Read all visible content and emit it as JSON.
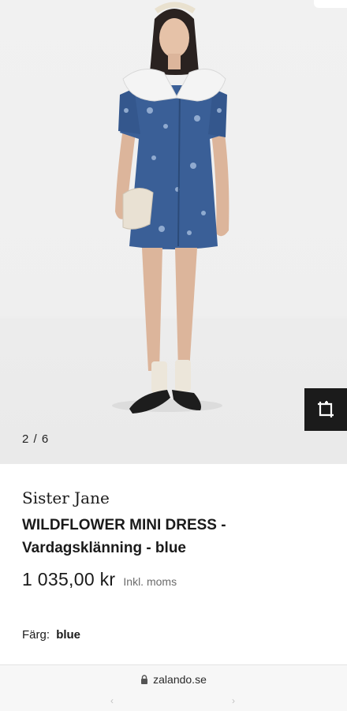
{
  "gallery": {
    "pager_text": "2 / 6",
    "image_alt": "Model wearing blue floral mini dress with white lace collar",
    "crop_icon": "crop-expand-icon"
  },
  "product": {
    "brand": "Sister Jane",
    "name": "WILDFLOWER MINI DRESS - Vardagsklänning - blue",
    "price": "1 035,00 kr",
    "vat_note": "Inkl. moms",
    "color_label": "Färg:",
    "color_value": "blue"
  },
  "browser": {
    "url": "zalando.se",
    "lock_icon": "lock-icon",
    "back_icon": "chevron-left-icon",
    "forward_icon": "chevron-right-icon"
  },
  "colors": {
    "dress": "#3a5f97",
    "collar": "#f4f4f4",
    "button_bg": "#1b1b1b"
  }
}
